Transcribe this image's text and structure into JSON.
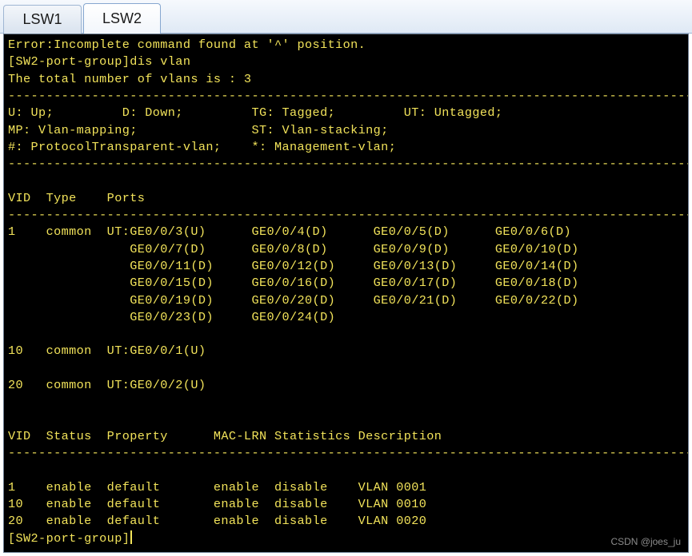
{
  "tabs": [
    {
      "label": "LSW1"
    },
    {
      "label": "LSW2"
    }
  ],
  "terminal": {
    "lines": [
      "Error:Incomplete command found at '^' position.",
      "[SW2-port-group]dis vlan",
      "The total number of vlans is : 3",
      "--------------------------------------------------------------------------------------------",
      "U: Up;         D: Down;         TG: Tagged;         UT: Untagged;",
      "MP: Vlan-mapping;               ST: Vlan-stacking;",
      "#: ProtocolTransparent-vlan;    *: Management-vlan;",
      "--------------------------------------------------------------------------------------------",
      "",
      "VID  Type    Ports",
      "--------------------------------------------------------------------------------------------",
      "1    common  UT:GE0/0/3(U)      GE0/0/4(D)      GE0/0/5(D)      GE0/0/6(D)",
      "                GE0/0/7(D)      GE0/0/8(D)      GE0/0/9(D)      GE0/0/10(D)",
      "                GE0/0/11(D)     GE0/0/12(D)     GE0/0/13(D)     GE0/0/14(D)",
      "                GE0/0/15(D)     GE0/0/16(D)     GE0/0/17(D)     GE0/0/18(D)",
      "                GE0/0/19(D)     GE0/0/20(D)     GE0/0/21(D)     GE0/0/22(D)",
      "                GE0/0/23(D)     GE0/0/24(D)",
      "",
      "10   common  UT:GE0/0/1(U)",
      "",
      "20   common  UT:GE0/0/2(U)",
      "",
      "",
      "VID  Status  Property      MAC-LRN Statistics Description",
      "--------------------------------------------------------------------------------------------",
      "",
      "1    enable  default       enable  disable    VLAN 0001",
      "10   enable  default       enable  disable    VLAN 0010",
      "20   enable  default       enable  disable    VLAN 0020",
      "[SW2-port-group]"
    ]
  },
  "watermark": "CSDN @joes_ju",
  "colors": {
    "terminal_bg": "#000000",
    "terminal_fg": "#f2e35a"
  }
}
